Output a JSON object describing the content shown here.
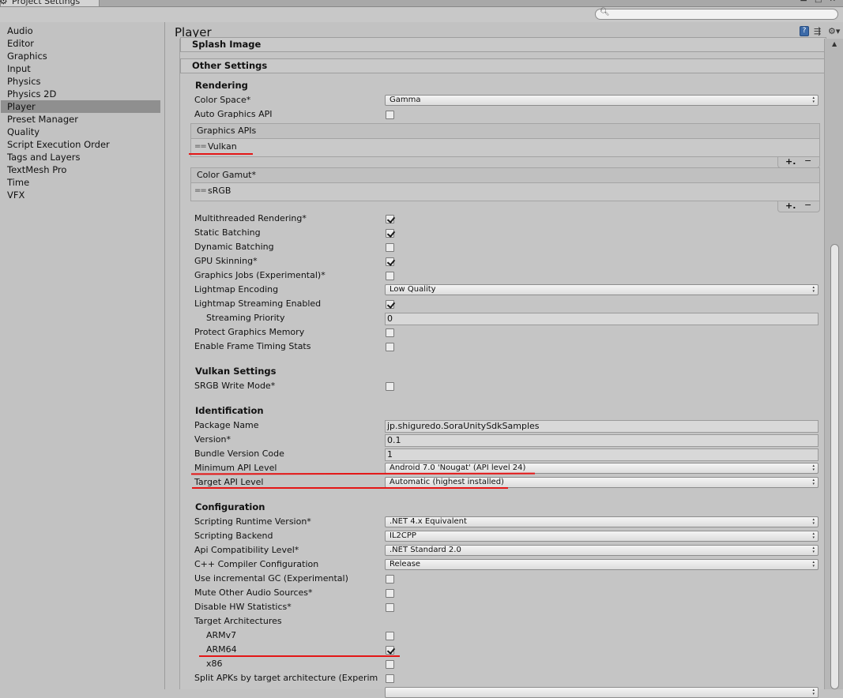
{
  "window": {
    "title": "Project Settings",
    "controls": "▬ □ ✕"
  },
  "search": {
    "placeholder": "",
    "value": ""
  },
  "sidebar": {
    "items": [
      {
        "label": "Audio"
      },
      {
        "label": "Editor"
      },
      {
        "label": "Graphics"
      },
      {
        "label": "Input"
      },
      {
        "label": "Physics"
      },
      {
        "label": "Physics 2D"
      },
      {
        "label": "Player",
        "selected": true
      },
      {
        "label": "Preset Manager"
      },
      {
        "label": "Quality"
      },
      {
        "label": "Script Execution Order"
      },
      {
        "label": "Tags and Layers"
      },
      {
        "label": "TextMesh Pro"
      },
      {
        "label": "Time"
      },
      {
        "label": "VFX"
      }
    ]
  },
  "main": {
    "title": "Player",
    "sections": {
      "splash": "Splash Image",
      "other": "Other Settings"
    }
  },
  "rendering": {
    "heading": "Rendering",
    "color_space_label": "Color Space*",
    "color_space_value": "Gamma",
    "auto_graphics_api_label": "Auto Graphics API",
    "auto_graphics_api": false,
    "graphics_apis_label": "Graphics APIs",
    "graphics_apis_item": "Vulkan",
    "color_gamut_label": "Color Gamut*",
    "color_gamut_item": "sRGB",
    "multithreaded_label": "Multithreaded Rendering*",
    "multithreaded": true,
    "static_batching_label": "Static Batching",
    "static_batching": true,
    "dynamic_batching_label": "Dynamic Batching",
    "dynamic_batching": false,
    "gpu_skinning_label": "GPU Skinning*",
    "gpu_skinning": true,
    "graphics_jobs_label": "Graphics Jobs (Experimental)*",
    "graphics_jobs": false,
    "lightmap_encoding_label": "Lightmap Encoding",
    "lightmap_encoding_value": "Low Quality",
    "lightmap_streaming_label": "Lightmap Streaming Enabled",
    "lightmap_streaming": true,
    "streaming_priority_label": "Streaming Priority",
    "streaming_priority_value": "0",
    "protect_memory_label": "Protect Graphics Memory",
    "protect_memory": false,
    "frame_timing_label": "Enable Frame Timing Stats",
    "frame_timing": false
  },
  "vulkan": {
    "heading": "Vulkan Settings",
    "srgb_write_label": "SRGB Write Mode*",
    "srgb_write": false
  },
  "identification": {
    "heading": "Identification",
    "package_name_label": "Package Name",
    "package_name_value": "jp.shiguredo.SoraUnitySdkSamples",
    "version_label": "Version*",
    "version_value": "0.1",
    "bundle_code_label": "Bundle Version Code",
    "bundle_code_value": "1",
    "min_api_label": "Minimum API Level",
    "min_api_value": "Android 7.0 'Nougat' (API level 24)",
    "target_api_label": "Target API Level",
    "target_api_value": "Automatic (highest installed)"
  },
  "configuration": {
    "heading": "Configuration",
    "runtime_label": "Scripting Runtime Version*",
    "runtime_value": ".NET 4.x Equivalent",
    "backend_label": "Scripting Backend",
    "backend_value": "IL2CPP",
    "api_compat_label": "Api Compatibility Level*",
    "api_compat_value": ".NET Standard 2.0",
    "cpp_config_label": "C++ Compiler Configuration",
    "cpp_config_value": "Release",
    "incremental_gc_label": "Use incremental GC (Experimental)",
    "incremental_gc": false,
    "mute_audio_label": "Mute Other Audio Sources*",
    "mute_audio": false,
    "hw_stats_label": "Disable HW Statistics*",
    "hw_stats": false,
    "target_arch_label": "Target Architectures",
    "armv7_label": "ARMv7",
    "armv7": false,
    "arm64_label": "ARM64",
    "arm64": true,
    "x86_label": "x86",
    "x86": false,
    "split_apks_label": "Split APKs by target architecture (Experim",
    "split_apks": false
  },
  "annotation_color": "#e41616"
}
